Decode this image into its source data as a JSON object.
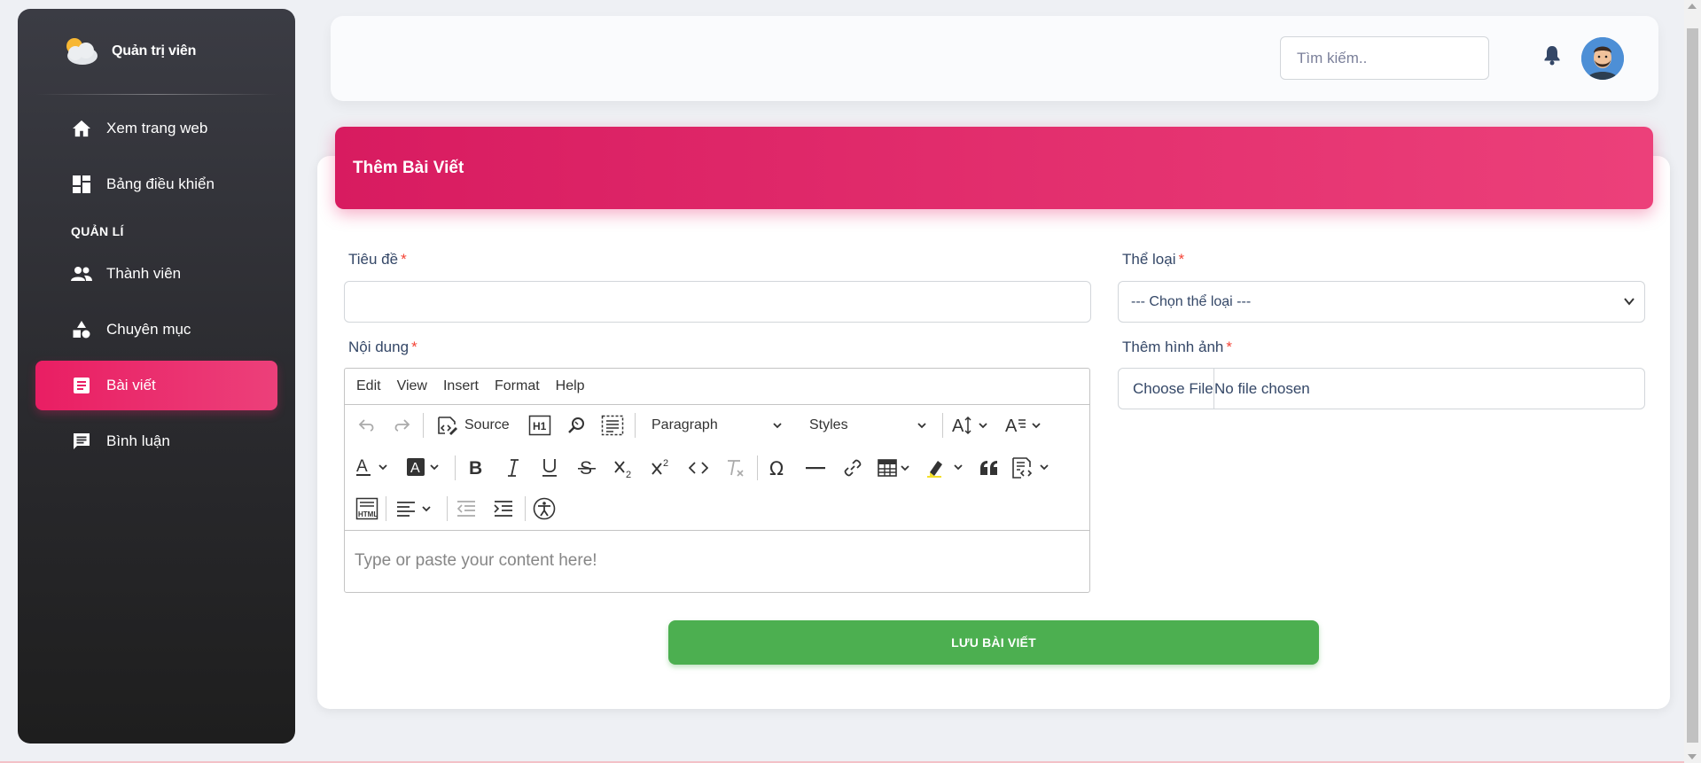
{
  "sidebar": {
    "brand": "Quản trị viên",
    "items_top": [
      {
        "label": "Xem trang web",
        "icon": "home-icon"
      },
      {
        "label": "Bảng điều khiển",
        "icon": "dashboard-icon"
      }
    ],
    "section_heading": "QUẢN LÍ",
    "items_manage": [
      {
        "label": "Thành viên",
        "icon": "people-icon"
      },
      {
        "label": "Chuyên mục",
        "icon": "category-icon"
      },
      {
        "label": "Bài viết",
        "icon": "article-icon",
        "active": true
      },
      {
        "label": "Bình luận",
        "icon": "comment-icon"
      }
    ]
  },
  "topbar": {
    "search_placeholder": "Tìm kiếm.."
  },
  "form": {
    "title": "Thêm Bài Viết",
    "title_label": "Tiêu đề",
    "category_label": "Thể loại",
    "category_selected": "--- Chọn thể loại ---",
    "content_label": "Nội dung",
    "image_label": "Thêm hình ảnh",
    "file_button": "Choose File",
    "file_status": "No file chosen",
    "required_mark": "*",
    "save_button": "LƯU BÀI VIẾT"
  },
  "editor": {
    "menu": [
      "Edit",
      "View",
      "Insert",
      "Format",
      "Help"
    ],
    "source_label": "Source",
    "heading_dropdown": "Paragraph",
    "styles_dropdown": "Styles",
    "placeholder": "Type or paste your content here!"
  },
  "colors": {
    "accent": "#e91e63",
    "save": "#4caf50",
    "required": "#f44335"
  }
}
